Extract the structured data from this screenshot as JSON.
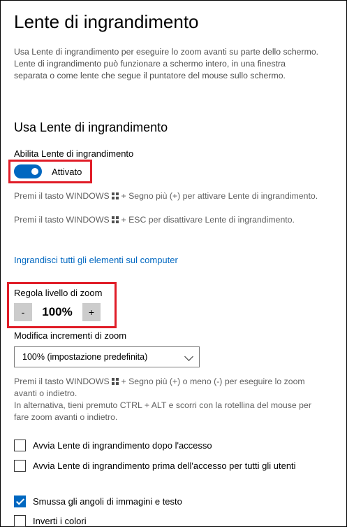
{
  "page": {
    "title": "Lente di ingrandimento",
    "description": "Usa Lente di ingrandimento per eseguire lo zoom avanti su parte dello schermo. Lente di ingrandimento può funzionare a schermo intero, in una finestra separata o come lente che segue il puntatore del mouse sullo schermo."
  },
  "section": {
    "heading": "Usa Lente di ingrandimento",
    "enable_label": "Abilita Lente di ingrandimento",
    "toggle_state": "Attivato",
    "hint_on_before": "Premi il tasto WINDOWS",
    "hint_on_after": "+ Segno più (+) per attivare Lente di ingrandimento.",
    "hint_off_before": "Premi il tasto WINDOWS",
    "hint_off_after": "+ ESC per disattivare Lente di ingrandimento.",
    "link_text": "Ingrandisci tutti gli elementi sul computer"
  },
  "zoom": {
    "label": "Regola livello di zoom",
    "minus": "-",
    "value": "100%",
    "plus": "+",
    "increment_label": "Modifica incrementi di zoom",
    "increment_selected": "100% (impostazione predefinita)",
    "hint1_before": "Premi il tasto WINDOWS",
    "hint1_after": "+ Segno più (+) o meno (-) per eseguire lo zoom avanti o indietro.",
    "hint2": "In alternativa, tieni premuto CTRL + ALT e scorri con la rotellina del mouse per fare zoom avanti o indietro."
  },
  "checkboxes": [
    {
      "label": "Avvia Lente di ingrandimento dopo l'accesso",
      "checked": false
    },
    {
      "label": "Avvia Lente di ingrandimento prima dell'accesso per tutti gli utenti",
      "checked": false
    },
    {
      "label": "Smussa gli angoli di immagini e testo",
      "checked": true
    },
    {
      "label": "Inverti i colori",
      "checked": false
    }
  ],
  "colors": {
    "accent": "#0067c0",
    "highlight_box": "#e01d28"
  },
  "icons": {
    "windows_key": "windows-logo-icon",
    "dropdown": "chevron-down-icon",
    "check": "checkmark-icon"
  }
}
